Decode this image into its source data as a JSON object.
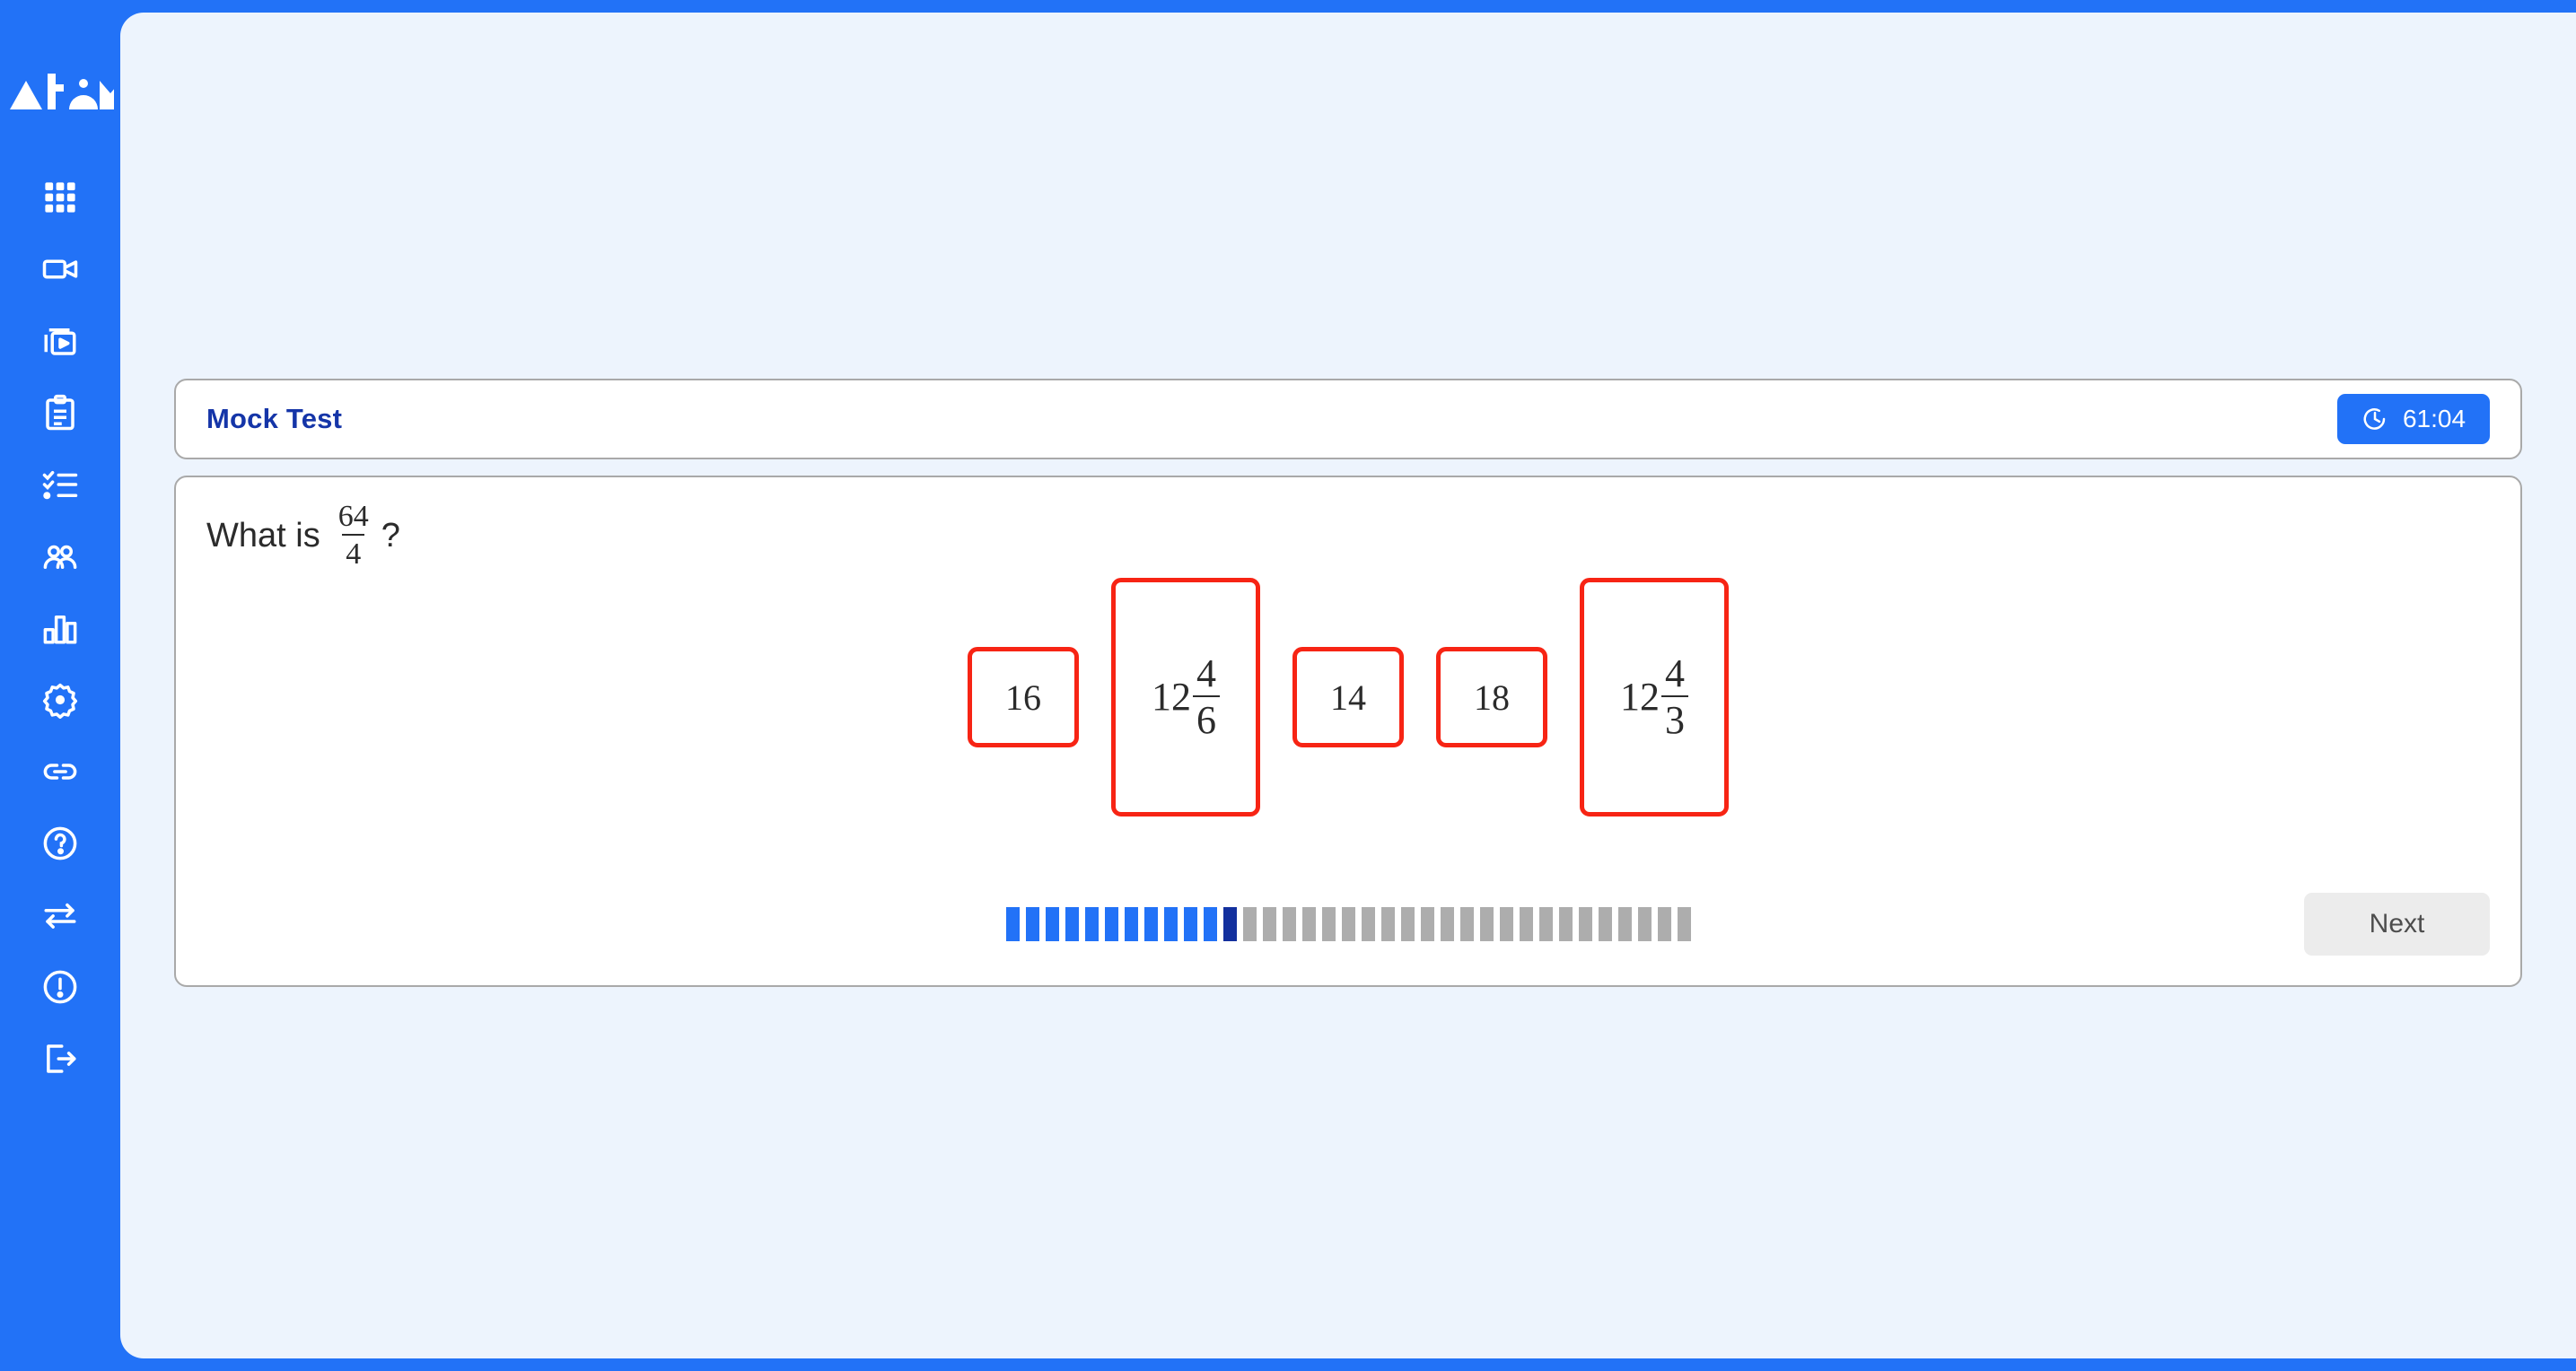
{
  "brand": {
    "logo_text": "Atom"
  },
  "sidebar": {
    "items": [
      {
        "icon": "grid-icon",
        "label": "Dashboard"
      },
      {
        "icon": "video-camera-icon",
        "label": "Live Class"
      },
      {
        "icon": "video-library-icon",
        "label": "Recordings"
      },
      {
        "icon": "clipboard-icon",
        "label": "Assignments"
      },
      {
        "icon": "checklist-icon",
        "label": "Tasks"
      },
      {
        "icon": "users-icon",
        "label": "Students"
      },
      {
        "icon": "bar-chart-icon",
        "label": "Reports"
      },
      {
        "icon": "gear-icon",
        "label": "Settings"
      },
      {
        "icon": "link-icon",
        "label": "Links"
      },
      {
        "icon": "help-circle-icon",
        "label": "Help"
      },
      {
        "icon": "swap-arrows-icon",
        "label": "Switch"
      },
      {
        "icon": "alert-circle-icon",
        "label": "Alerts"
      },
      {
        "icon": "logout-icon",
        "label": "Log out"
      }
    ]
  },
  "header": {
    "title": "Mock Test",
    "timer_icon": "stopwatch-icon",
    "timer_value": "61:04"
  },
  "question": {
    "prefix": "What is",
    "fraction": {
      "numerator": "64",
      "denominator": "4"
    },
    "suffix": "?",
    "options": [
      {
        "id": "opt-1",
        "kind": "number",
        "value": "16"
      },
      {
        "id": "opt-2",
        "kind": "mixed",
        "whole": "12",
        "numerator": "4",
        "denominator": "6"
      },
      {
        "id": "opt-3",
        "kind": "number",
        "value": "14"
      },
      {
        "id": "opt-4",
        "kind": "number",
        "value": "18"
      },
      {
        "id": "opt-5",
        "kind": "mixed",
        "whole": "12",
        "numerator": "4",
        "denominator": "3"
      }
    ]
  },
  "footer": {
    "next_label": "Next",
    "progress": {
      "total": 35,
      "completed": 11,
      "current_index": 12,
      "colors": {
        "done": "#2272f7",
        "current": "#13309e",
        "todo": "#adadad"
      }
    }
  },
  "colors": {
    "brand_blue": "#2272f7",
    "panel_bg": "#edf4fd",
    "title_blue": "#1535a8",
    "option_border_red": "#f72414",
    "next_bg": "#ececec"
  }
}
